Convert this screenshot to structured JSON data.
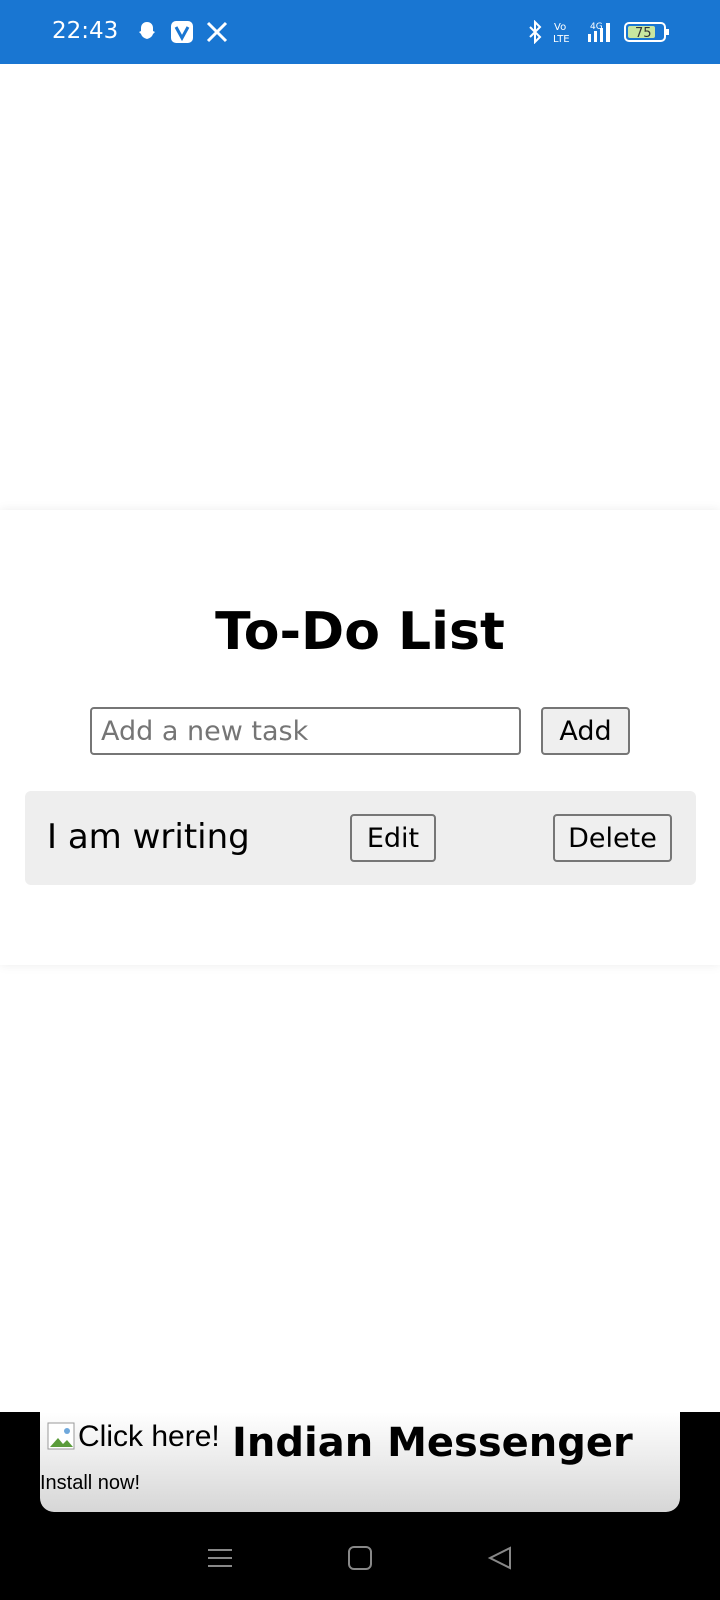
{
  "status": {
    "time": "22:43",
    "battery": "75",
    "network": "4G",
    "volte": "Vo LTE",
    "left_icons": [
      "snapchat-icon",
      "v-app-icon",
      "x-icon"
    ],
    "right_icons": [
      "bluetooth-icon",
      "volte-icon",
      "signal-icon",
      "battery-icon"
    ]
  },
  "todo": {
    "title": "To-Do List",
    "input_placeholder": "Add a new task",
    "input_value": "",
    "add_label": "Add",
    "tasks": [
      {
        "text": "I am writing",
        "edit_label": "Edit",
        "delete_label": "Delete"
      }
    ]
  },
  "ad": {
    "click_text": "Click here!",
    "app_name": "Indian Messenger",
    "install_text": "Install now!"
  },
  "nav": {
    "items": [
      "recents-icon",
      "home-icon",
      "back-icon"
    ]
  },
  "colors": {
    "statusbar": "#1976d2",
    "task_row_bg": "#eeeeee",
    "button_bg": "#efefef"
  }
}
